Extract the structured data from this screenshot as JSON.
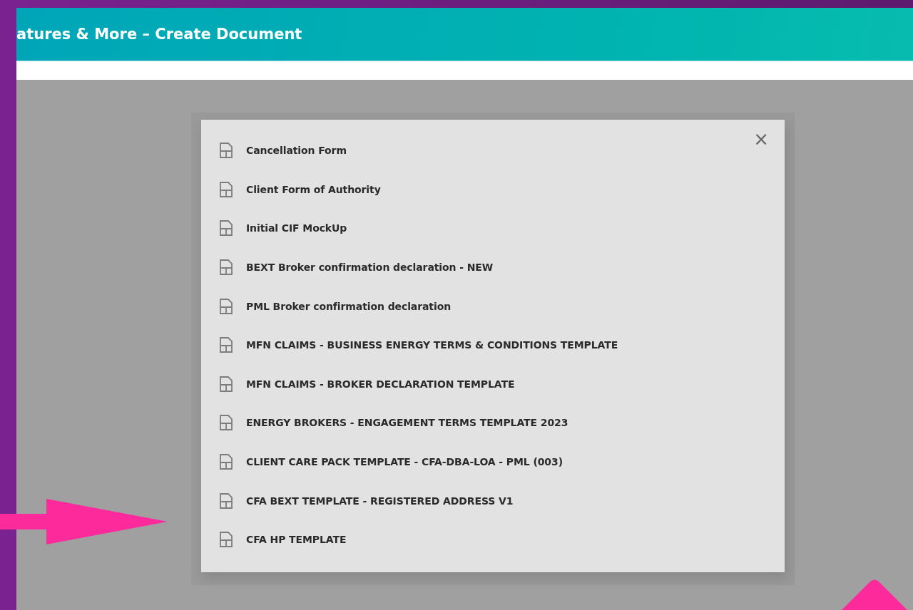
{
  "header": {
    "title": "atures & More – Create Document"
  },
  "dialog": {
    "close": "×",
    "templates": [
      {
        "name": "Cancellation Form"
      },
      {
        "name": "Client Form of Authority"
      },
      {
        "name": "Initial CIF MockUp"
      },
      {
        "name": "BEXT Broker confirmation declaration - NEW"
      },
      {
        "name": "PML Broker confirmation declaration"
      },
      {
        "name": "MFN CLAIMS - BUSINESS ENERGY TERMS & CONDITIONS TEMPLATE"
      },
      {
        "name": "MFN CLAIMS - BROKER DECLARATION TEMPLATE"
      },
      {
        "name": "ENERGY BROKERS - ENGAGEMENT TERMS TEMPLATE 2023"
      },
      {
        "name": "CLIENT CARE PACK TEMPLATE - CFA-DBA-LOA - PML (003)"
      },
      {
        "name": "CFA BEXT TEMPLATE - REGISTERED ADDRESS V1"
      },
      {
        "name": "CFA HP TEMPLATE"
      }
    ]
  }
}
